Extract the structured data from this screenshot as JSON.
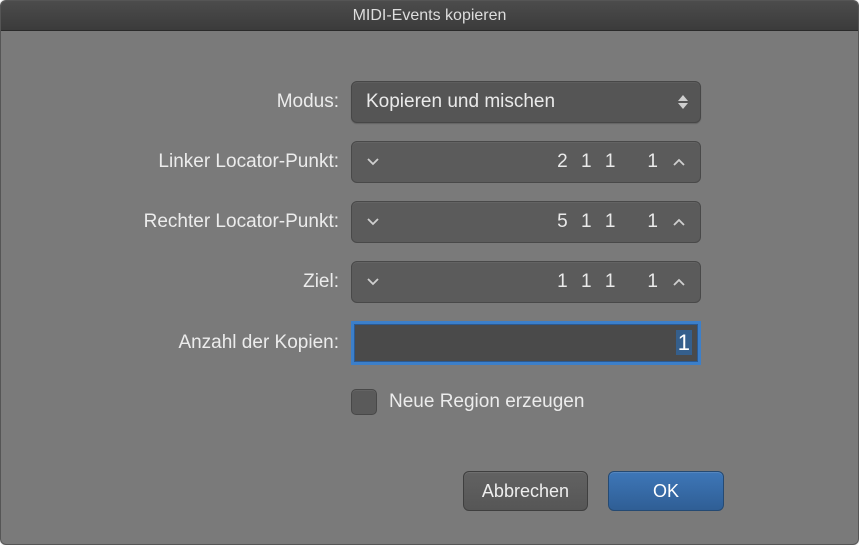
{
  "window": {
    "title": "MIDI-Events kopieren"
  },
  "labels": {
    "mode": "Modus:",
    "left_locator": "Linker Locator-Punkt:",
    "right_locator": "Rechter Locator-Punkt:",
    "destination": "Ziel:",
    "copies": "Anzahl der Kopien:"
  },
  "mode_select": {
    "value": "Kopieren und mischen"
  },
  "left_locator": {
    "a": "2",
    "b": "1",
    "c": "1",
    "d": "1"
  },
  "right_locator": {
    "a": "5",
    "b": "1",
    "c": "1",
    "d": "1"
  },
  "destination": {
    "a": "1",
    "b": "1",
    "c": "1",
    "d": "1"
  },
  "copies_field": {
    "value": "1"
  },
  "checkbox": {
    "label": "Neue Region erzeugen",
    "checked": false
  },
  "buttons": {
    "cancel": "Abbrechen",
    "ok": "OK"
  }
}
